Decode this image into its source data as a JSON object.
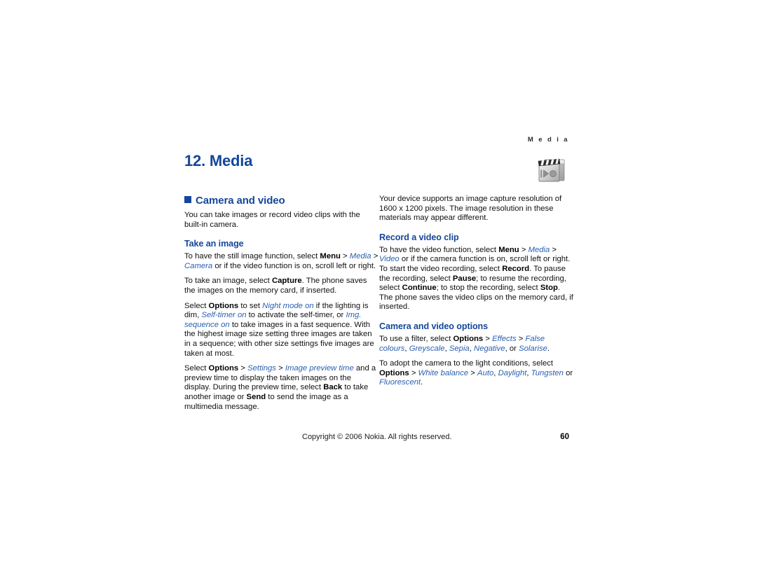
{
  "running_head": "M e d i a",
  "chapter": {
    "title": "12. Media",
    "icon_name": "media-clapperboard-icon"
  },
  "colors": {
    "heading_blue": "#14479b",
    "italic_blue": "#2a5fb0",
    "body_black": "#111111"
  },
  "left_column": {
    "section_title": "Camera and video",
    "intro": "You can take images or record video clips with the built-in camera.",
    "subsection_title": "Take an image",
    "p1": {
      "t1": "To have the still image function, select ",
      "b1": "Menu",
      "g1": " > ",
      "i1": "Media",
      "g2": " > ",
      "i2": "Camera",
      "t2": " or if the video function is on, scroll left or right."
    },
    "p2": {
      "t1": "To take an image, select ",
      "b1": "Capture",
      "t2": ". The phone saves the images on the memory card, if inserted."
    },
    "p3": {
      "t1": "Select ",
      "b1": "Options",
      "t2": " to set ",
      "i1": "Night mode on",
      "t3": " if the lighting is dim, ",
      "i2": "Self-timer on",
      "t4": " to activate the self-timer, or ",
      "i3": "Img. sequence on",
      "t5": " to take images in a fast sequence. With the highest image size setting three images are taken in a sequence; with other size settings five images are taken at most."
    },
    "p4": {
      "t1": "Select ",
      "b1": "Options",
      "g1": " > ",
      "i1": "Settings",
      "g2": " > ",
      "i2": "Image preview time",
      "t2": " and a preview time to display the taken images on the display. During the preview time, select ",
      "b2": "Back",
      "t3": " to take another image or ",
      "b3": "Send",
      "t4": " to send the image as a multimedia message."
    }
  },
  "right_column": {
    "intro": "Your device supports an image capture resolution of 1600 x 1200 pixels. The image resolution in these materials may appear different.",
    "subsection1_title": "Record a video clip",
    "p1": {
      "t1": "To have the video function, select ",
      "b1": "Menu",
      "g1": " > ",
      "i1": "Media",
      "g2": " > ",
      "i2": "Video",
      "t2": " or if the camera function is on, scroll left or right. To start the video recording, select ",
      "b2": "Record",
      "t3": ". To pause the recording, select ",
      "b3": "Pause",
      "t4": "; to resume the recording, select ",
      "b4": "Continue",
      "t5": "; to stop the recording, select ",
      "b5": "Stop",
      "t6": ". The phone saves the video clips on the memory card, if inserted."
    },
    "subsection2_title": "Camera and video options",
    "p2": {
      "t1": "To use a filter, select ",
      "b1": "Options",
      "g1": " > ",
      "i1": "Effects",
      "g2": " > ",
      "i2": "False colours",
      "t2": ", ",
      "i3": "Greyscale",
      "t3": ", ",
      "i4": "Sepia",
      "t4": ", ",
      "i5": "Negative",
      "t5": ", or ",
      "i6": "Solarise",
      "t6": "."
    },
    "p3": {
      "t1": "To adopt the camera to the light conditions, select ",
      "b1": "Options",
      "g1": " > ",
      "i1": "White balance",
      "g2": " > ",
      "i2": "Auto",
      "t2": ", ",
      "i3": "Daylight",
      "t3": ", ",
      "i4": "Tungsten",
      "t4": " or ",
      "i5": "Fluorescent",
      "t5": "."
    }
  },
  "footer": {
    "copyright": "Copyright © 2006 Nokia. All rights reserved.",
    "page_number": "60"
  }
}
